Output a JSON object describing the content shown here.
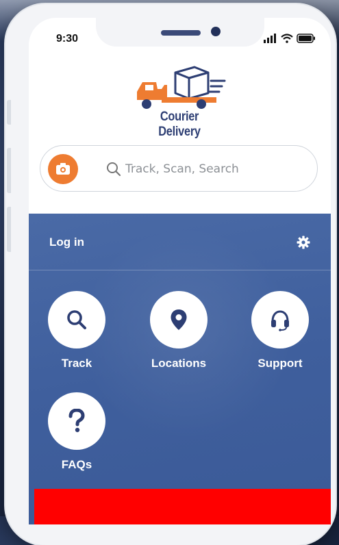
{
  "status_bar": {
    "time": "9:30"
  },
  "brand": {
    "name": "Courier Delivery",
    "accent": "#ee7c31",
    "primary": "#2d3e73"
  },
  "search": {
    "placeholder": "Track, Scan, Search",
    "value": ""
  },
  "account": {
    "login_label": "Log in"
  },
  "tiles": [
    {
      "label": "Track",
      "icon": "search-icon"
    },
    {
      "label": "Locations",
      "icon": "location-pin-icon"
    },
    {
      "label": "Support",
      "icon": "headset-icon"
    },
    {
      "label": "FAQs",
      "icon": "question-mark-icon"
    }
  ],
  "colors": {
    "panel": "#4265a2",
    "banner": "#ff0000"
  }
}
